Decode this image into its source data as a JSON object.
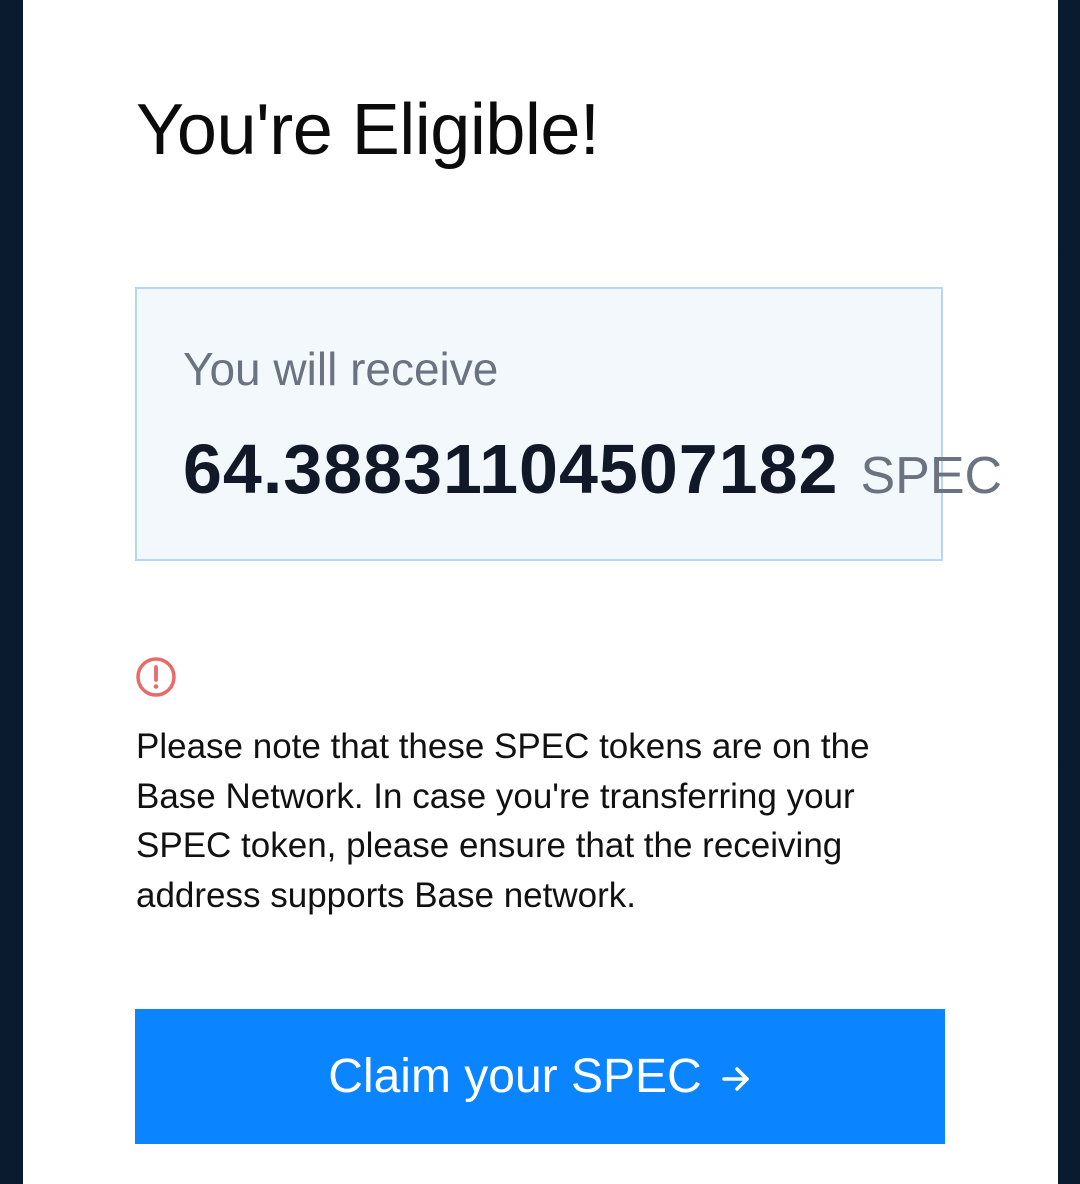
{
  "heading": {
    "title": "You're Eligible!"
  },
  "reward": {
    "label": "You will receive",
    "amount": "64.38831104507182",
    "unit": "SPEC"
  },
  "notice": {
    "icon": "alert-circle-icon",
    "icon_color": "#e86a6a",
    "text": "Please note that these SPEC tokens are on the Base Network. In case you're transferring your SPEC token, please ensure that the receiving address supports Base network."
  },
  "claim": {
    "label": "Claim your SPEC",
    "icon": "arrow-right-icon",
    "color": "#0a84ff"
  },
  "colors": {
    "page_background": "#0b1c33",
    "card_background": "#ffffff",
    "receive_box_background": "#f3f8fd",
    "receive_box_border": "#b8d6ef"
  }
}
